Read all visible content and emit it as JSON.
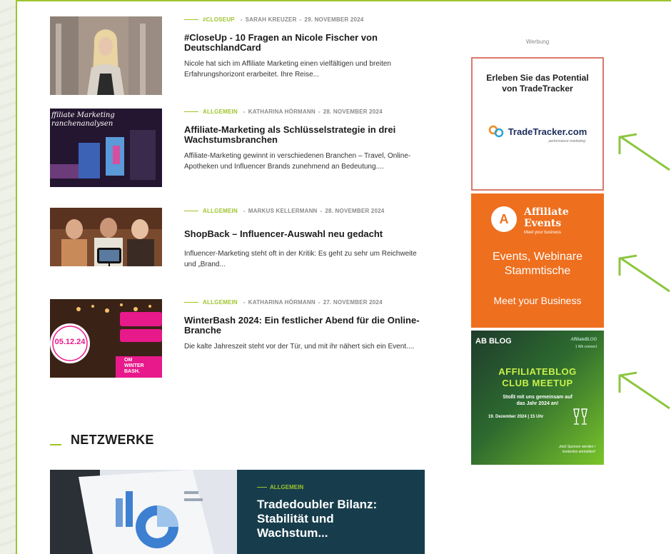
{
  "articles": [
    {
      "category": "#CLOSEUP",
      "author": "SARAH KREUZER",
      "date": "29. NOVEMBER 2024",
      "title": "#CloseUp - 10 Fragen an Nicole Fischer von DeutschlandCard",
      "excerpt": "Nicole hat sich im Affiliate Marketing einen vielfältigen und breiten Erfahrungshorizont erarbeitet. Ihre Reise..."
    },
    {
      "category": "ALLGEMEIN",
      "author": "KATHARINA HÖRMANN",
      "date": "28. NOVEMBER 2024",
      "title": "Affiliate-Marketing als Schlüsselstrategie in drei Wachstumsbranchen",
      "excerpt": "Affiliate-Marketing gewinnt in verschiedenen Branchen – Travel, Online-Apotheken und Influencer Brands zunehmend an Bedeutung....",
      "thumb_text_1": "ffiliate Marketing",
      "thumb_text_2": "ranchenanalysen"
    },
    {
      "category": "ALLGEMEIN",
      "author": "MARKUS KELLERMANN",
      "date": "28. NOVEMBER 2024",
      "title": "ShopBack – Influencer-Auswahl neu gedacht",
      "excerpt": "Influencer-Marketing steht oft in der Kritik: Es geht zu sehr um Reichweite und „Brand..."
    },
    {
      "category": "ALLGEMEIN",
      "author": "KATHARINA HÖRMANN",
      "date": "27. NOVEMBER 2024",
      "title": "WinterBash 2024: Ein festlicher Abend für die Online-Branche",
      "excerpt": "Die kalte Jahreszeit steht vor der Tür, und mit ihr nähert sich ein Event....",
      "thumb_date": "05.12.24",
      "thumb_logo_1": "OM",
      "thumb_logo_2": "WINTER",
      "thumb_logo_3": "BASH."
    }
  ],
  "section": {
    "title": "NETZWERKE"
  },
  "featured": {
    "category": "ALLGEMEIN",
    "title": "Tradedoubler Bilanz: Stabilität und Wachstum..."
  },
  "ads": {
    "label": "Werbung",
    "tradetracker": {
      "headline": "Erleben Sie das Potential von TradeTracker",
      "logo": "TradeTracker.com",
      "tagline": "performance marketing"
    },
    "affiliate_events": {
      "badge": "A",
      "brand_1": "Affiliate",
      "brand_2": "Events",
      "brand_3": "Meet your business",
      "line_1": "Events, Webinare",
      "line_2": "Stammtische",
      "line_3": "Meet your Business"
    },
    "affiliateblog": {
      "logo": "AB BLOG",
      "signature": "AffiliateBLOG",
      "signature_sub": "1 Wk connect",
      "title_1": "AFFILIATEBLOG",
      "title_2": "CLUB MEETUP",
      "sub_1": "Stoßt mit uns gemeinsam auf",
      "sub_2": "das Jahr 2024 an!",
      "date": "19. Dezember 2024 | 15 Uhr",
      "foot_1": "Jetzt Sponsor werden /",
      "foot_2": "kostenlos anmelden!"
    }
  },
  "colors": {
    "accent": "#9ec42c",
    "dark_panel": "#173d4c",
    "orange": "#ee6f1e",
    "arrow": "#8cc63f"
  }
}
